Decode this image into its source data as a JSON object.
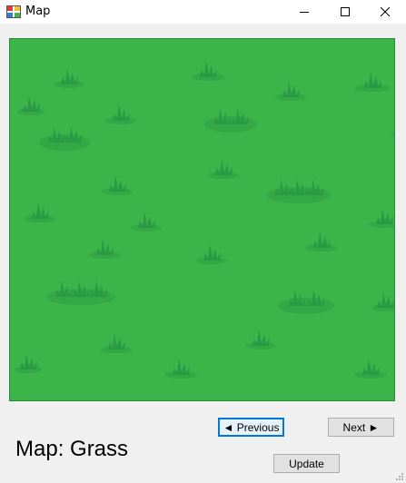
{
  "window": {
    "title": "Map",
    "icon": "app-map-icon"
  },
  "map": {
    "terrain_color": "#3bb54a",
    "tuft_color": "#2a9a44",
    "shadow_color": "#33a845"
  },
  "labels": {
    "map_name": "Map: Grass"
  },
  "buttons": {
    "previous": "◄ Previous",
    "next": "Next ►",
    "update": "Update"
  },
  "colors": {
    "focus_border": "#0078d7",
    "button_face": "#e1e1e1"
  }
}
